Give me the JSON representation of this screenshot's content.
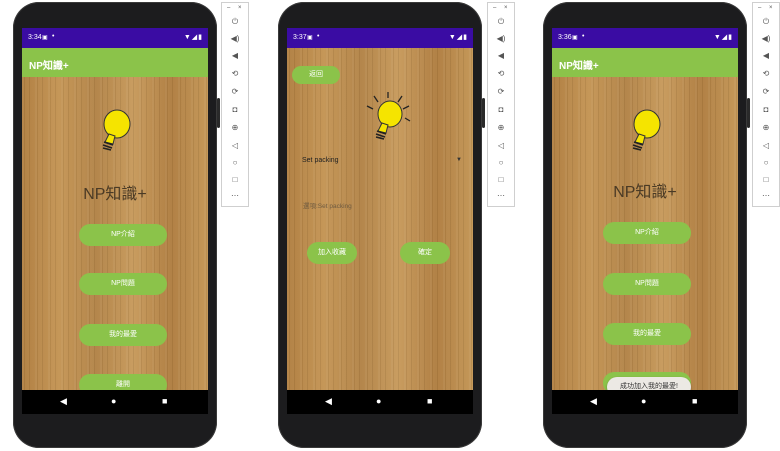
{
  "screens": [
    {
      "status": {
        "time": "3:34",
        "icon": "sim-icon",
        "signal": "▼◢▮"
      },
      "appbar_title": "NP知識+",
      "headline": "NP知識+",
      "buttons": [
        "NP介紹",
        "NP問題",
        "我的最愛",
        "離開"
      ]
    },
    {
      "status": {
        "time": "3:37",
        "icon": "sim-icon",
        "signal": "▼◢▮"
      },
      "back_label": "返回",
      "spinner_value": "Set packing",
      "selected_text": "選項:Set packing",
      "add_favorite_label": "加入收藏",
      "confirm_label": "確定"
    },
    {
      "status": {
        "time": "3:36",
        "icon": "sim-icon",
        "signal": "▼◢▮"
      },
      "appbar_title": "NP知識+",
      "headline": "NP知識+",
      "buttons": [
        "NP介紹",
        "NP問題",
        "我的最愛"
      ],
      "toast": "成功加入我的最愛!"
    }
  ],
  "emulator_toolbar": {
    "icons": [
      "power-icon",
      "volume-up-icon",
      "volume-down-icon",
      "rotate-left-icon",
      "rotate-right-icon",
      "camera-icon",
      "zoom-icon",
      "back-icon",
      "home-icon",
      "overview-icon",
      "more-icon"
    ],
    "glyphs": [
      "⏻",
      "🔊",
      "🔉",
      "⟲",
      "⟳",
      "◘",
      "⊕",
      "◁",
      "○",
      "□",
      "⋯"
    ]
  },
  "colors": {
    "accent_green": "#8bc34a",
    "status_bar": "#3a0ca3"
  }
}
